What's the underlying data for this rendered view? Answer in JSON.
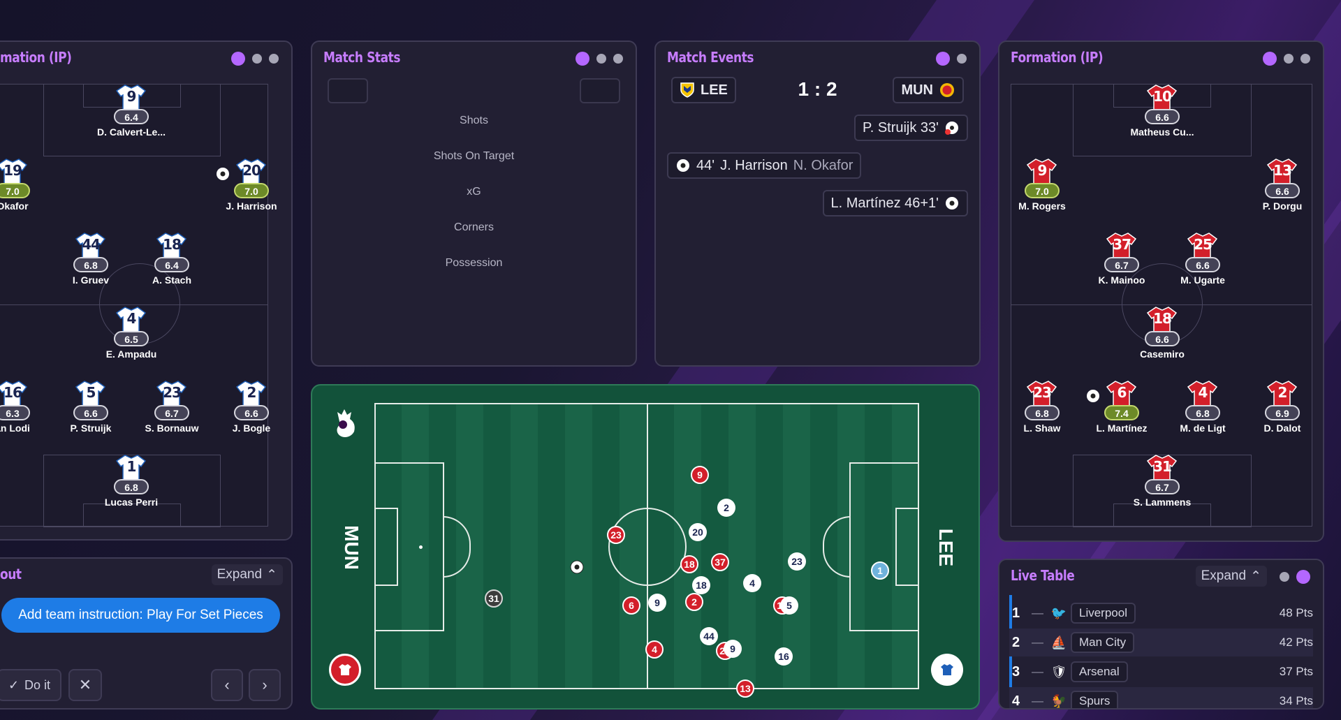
{
  "colors": {
    "accent": "#c77dff",
    "home_shirt": "#ffffff",
    "away_shirt": "#d31f2a",
    "pitch": "#12523a"
  },
  "left_formation": {
    "title": "mation (IP)",
    "players": [
      {
        "num": "9",
        "rating": "6.4",
        "name": "D. Calvert-Le..."
      },
      {
        "num": "19",
        "rating": "7.0",
        "name": "Okafor"
      },
      {
        "num": "20",
        "rating": "7.0",
        "name": "J. Harrison"
      },
      {
        "num": "44",
        "rating": "6.8",
        "name": "I. Gruev"
      },
      {
        "num": "18",
        "rating": "6.4",
        "name": "A. Stach"
      },
      {
        "num": "4",
        "rating": "6.5",
        "name": "E. Ampadu"
      },
      {
        "num": "16",
        "rating": "6.3",
        "name": "an Lodi"
      },
      {
        "num": "5",
        "rating": "6.6",
        "name": "P. Struijk"
      },
      {
        "num": "23",
        "rating": "6.7",
        "name": "S. Bornauw"
      },
      {
        "num": "2",
        "rating": "6.6",
        "name": "J. Bogle"
      },
      {
        "num": "1",
        "rating": "6.8",
        "name": "Lucas Perri"
      }
    ]
  },
  "match_stats": {
    "title": "Match Stats",
    "rows": [
      "Shots",
      "Shots On Target",
      "xG",
      "Corners",
      "Possession"
    ]
  },
  "match_events": {
    "title": "Match Events",
    "home": "LEE",
    "away": "MUN",
    "score": "1 : 2",
    "events": [
      {
        "text": "P. Struijk 33'"
      },
      {
        "minute": "44'",
        "scorer": "J. Harrison",
        "assist": "N. Okafor"
      },
      {
        "text": "L. Martínez 46+1'"
      }
    ]
  },
  "right_formation": {
    "title": "Formation (IP)",
    "players": [
      {
        "num": "10",
        "rating": "6.6",
        "name": "Matheus Cu..."
      },
      {
        "num": "9",
        "rating": "7.0",
        "name": "M. Rogers"
      },
      {
        "num": "13",
        "rating": "6.6",
        "name": "P. Dorgu"
      },
      {
        "num": "37",
        "rating": "6.7",
        "name": "K. Mainoo"
      },
      {
        "num": "25",
        "rating": "6.6",
        "name": "M. Ugarte"
      },
      {
        "num": "18",
        "rating": "6.6",
        "name": "Casemiro"
      },
      {
        "num": "23",
        "rating": "6.8",
        "name": "L. Shaw"
      },
      {
        "num": "6",
        "rating": "7.4",
        "name": "L. Martínez"
      },
      {
        "num": "4",
        "rating": "6.8",
        "name": "M. de Ligt"
      },
      {
        "num": "2",
        "rating": "6.9",
        "name": "D. Dalot"
      },
      {
        "num": "31",
        "rating": "6.7",
        "name": "S. Lammens"
      }
    ]
  },
  "touchline": {
    "title": "out",
    "expand": "Expand",
    "suggestion": "Add team instruction: Play For Set Pieces",
    "do_it": "Do it"
  },
  "pitch_view": {
    "left_label": "MUN",
    "right_label": "LEE",
    "markers": [
      {
        "num": "9",
        "team": "r"
      },
      {
        "num": "2",
        "team": "w"
      },
      {
        "num": "20",
        "team": "w"
      },
      {
        "num": "23",
        "team": "r"
      },
      {
        "num": "18",
        "team": "r"
      },
      {
        "num": "37",
        "team": "r"
      },
      {
        "num": "18",
        "team": "w"
      },
      {
        "num": "4",
        "team": "w"
      },
      {
        "num": "23",
        "team": "w"
      },
      {
        "num": "6",
        "team": "r"
      },
      {
        "num": "9",
        "team": "w"
      },
      {
        "num": "2",
        "team": "r"
      },
      {
        "num": "10",
        "team": "r"
      },
      {
        "num": "5",
        "team": "w"
      },
      {
        "num": "44",
        "team": "w"
      },
      {
        "num": "4",
        "team": "r"
      },
      {
        "num": "25",
        "team": "r"
      },
      {
        "num": "9",
        "team": "w"
      },
      {
        "num": "16",
        "team": "w"
      },
      {
        "num": "13",
        "team": "r"
      },
      {
        "num": "31",
        "team": "g"
      },
      {
        "num": "1",
        "team": "b"
      }
    ]
  },
  "live_table": {
    "title": "Live Table",
    "expand": "Expand",
    "rows": [
      {
        "pos": "1",
        "team": "Liverpool",
        "pts": "48 Pts",
        "crest": "🐦"
      },
      {
        "pos": "2",
        "team": "Man City",
        "pts": "42 Pts",
        "crest": "⛵"
      },
      {
        "pos": "3",
        "team": "Arsenal",
        "pts": "37 Pts",
        "crest": "🛡"
      },
      {
        "pos": "4",
        "team": "Spurs",
        "pts": "34 Pts",
        "crest": "🐓"
      }
    ]
  }
}
